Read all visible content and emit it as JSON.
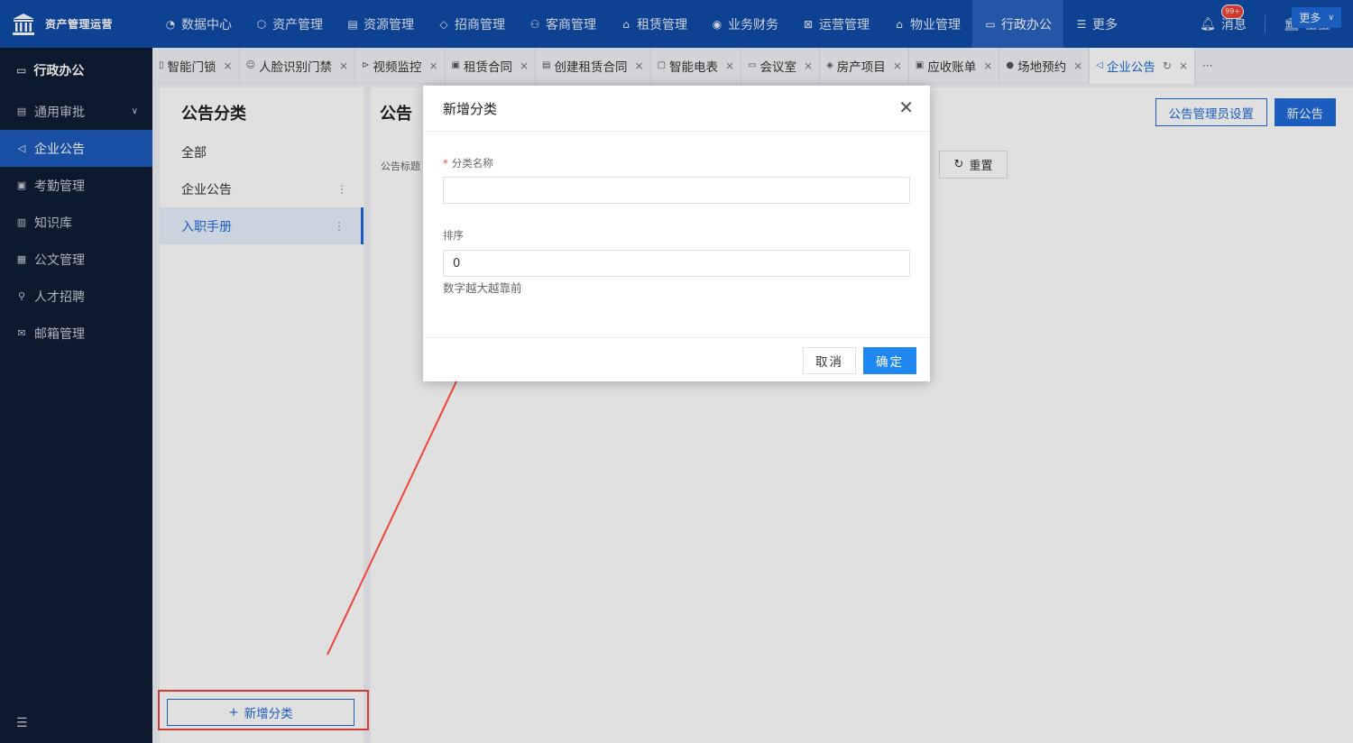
{
  "app": {
    "title": "资产管理运营"
  },
  "topnav": [
    {
      "label": "数据中心",
      "icon": "◔"
    },
    {
      "label": "资产管理",
      "icon": "⬡"
    },
    {
      "label": "资源管理",
      "icon": "▤"
    },
    {
      "label": "招商管理",
      "icon": "◇"
    },
    {
      "label": "客商管理",
      "icon": "⚇"
    },
    {
      "label": "租赁管理",
      "icon": "⌂"
    },
    {
      "label": "业务财务",
      "icon": "◉"
    },
    {
      "label": "运营管理",
      "icon": "⊠"
    },
    {
      "label": "物业管理",
      "icon": "⌂"
    },
    {
      "label": "行政办公",
      "icon": "▭"
    },
    {
      "label": "更多",
      "icon": "☰"
    }
  ],
  "header": {
    "messages_label": "消息",
    "messages_badge": "99+",
    "user_name": "莹莹"
  },
  "sidebar": {
    "title": "行政办公",
    "items": [
      {
        "label": "通用审批",
        "icon": "▤"
      },
      {
        "label": "企业公告",
        "icon": "◁"
      },
      {
        "label": "考勤管理",
        "icon": "▣"
      },
      {
        "label": "知识库",
        "icon": "▥"
      },
      {
        "label": "公文管理",
        "icon": "▦"
      },
      {
        "label": "人才招聘",
        "icon": "⚲"
      },
      {
        "label": "邮箱管理",
        "icon": "✉"
      }
    ]
  },
  "tabs": [
    {
      "label": "智能门锁",
      "icon": "▯"
    },
    {
      "label": "人脸识别门禁",
      "icon": "☺"
    },
    {
      "label": "视频监控",
      "icon": "⊳"
    },
    {
      "label": "租赁合同",
      "icon": "▣"
    },
    {
      "label": "创建租赁合同",
      "icon": "▤"
    },
    {
      "label": "智能电表",
      "icon": "▢"
    },
    {
      "label": "会议室",
      "icon": "▭"
    },
    {
      "label": "房产项目",
      "icon": "◈"
    },
    {
      "label": "应收账单",
      "icon": "▣"
    },
    {
      "label": "场地预约",
      "icon": "●"
    },
    {
      "label": "企业公告",
      "icon": "◁"
    }
  ],
  "tabs_more": "更多",
  "category": {
    "title": "公告分类",
    "items": [
      "全部",
      "企业公告",
      "入职手册"
    ],
    "add_label": "新增分类"
  },
  "main": {
    "title": "公告",
    "admin_button": "公告管理员设置",
    "new_button": "新公告",
    "filter_label": "公告标题",
    "reset_button": "重置"
  },
  "modal": {
    "title": "新增分类",
    "name_label": "分类名称",
    "name_value": "",
    "sort_label": "排序",
    "sort_value": "0",
    "sort_help": "数字越大越靠前",
    "cancel": "取消",
    "ok": "确定"
  },
  "colors": {
    "primary": "#1e6ad9",
    "topbar": "#0f4aa6",
    "sidebar": "#0f1d33",
    "highlight": "#f0433a"
  }
}
